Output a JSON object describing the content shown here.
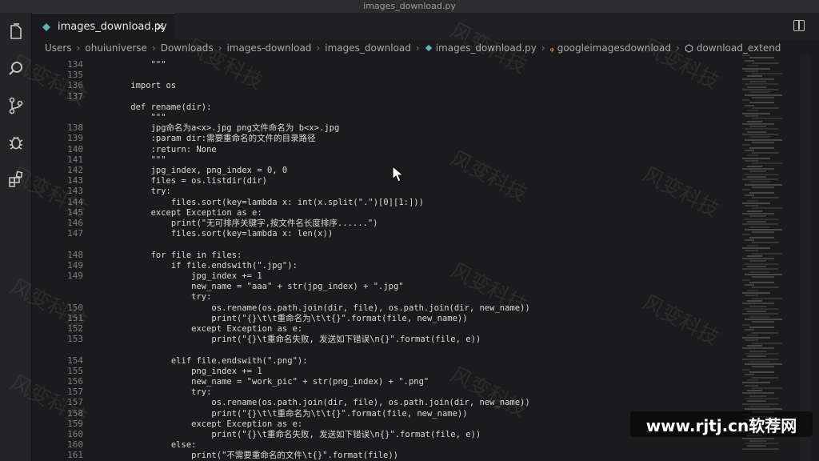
{
  "window": {
    "title": "images_download.py"
  },
  "tab": {
    "label": "images_download.py"
  },
  "breadcrumb": [
    "Users",
    "ohuiuniverse",
    "Downloads",
    "images-download",
    "images_download",
    "images_download.py",
    "googleimagesdownload",
    "download_extended_page"
  ],
  "code_lines": [
    {
      "n": "134",
      "text": "        \"\"\""
    },
    {
      "n": "135",
      "text": ""
    },
    {
      "n": "136",
      "text": "    import os"
    },
    {
      "n": "137",
      "text": ""
    },
    {
      "n": "",
      "text": "    def rename(dir):"
    },
    {
      "n": "",
      "text": "        \"\"\""
    },
    {
      "n": "138",
      "text": "        jpg命名为a<x>.jpg png文件命名为 b<x>.jpg"
    },
    {
      "n": "139",
      "text": "        :param dir:需要重命名的文件的目录路径"
    },
    {
      "n": "140",
      "text": "        :return: None"
    },
    {
      "n": "141",
      "text": "        \"\"\""
    },
    {
      "n": "142",
      "text": "        jpg_index, png_index = 0, 0"
    },
    {
      "n": "143",
      "text": "        files = os.listdir(dir)"
    },
    {
      "n": "143",
      "text": "        try:"
    },
    {
      "n": "144",
      "text": "            files.sort(key=lambda x: int(x.split(\".\")[0][1:]))"
    },
    {
      "n": "145",
      "text": "        except Exception as e:"
    },
    {
      "n": "146",
      "text": "            print(\"无可排序关键字,按文件名长度排序......\")"
    },
    {
      "n": "147",
      "text": "            files.sort(key=lambda x: len(x))"
    },
    {
      "n": "",
      "text": ""
    },
    {
      "n": "148",
      "text": "        for file in files:"
    },
    {
      "n": "149",
      "text": "            if file.endswith(\".jpg\"):"
    },
    {
      "n": "149",
      "text": "                jpg_index += 1"
    },
    {
      "n": "",
      "text": "                new_name = \"aaa\" + str(jpg_index) + \".jpg\""
    },
    {
      "n": "",
      "text": "                try:"
    },
    {
      "n": "150",
      "text": "                    os.rename(os.path.join(dir, file), os.path.join(dir, new_name))"
    },
    {
      "n": "151",
      "text": "                    print(\"{}\\t\\t重命名为\\t\\t{}\".format(file, new_name))"
    },
    {
      "n": "152",
      "text": "                except Exception as e:"
    },
    {
      "n": "153",
      "text": "                    print(\"{}\\t重命名失败, 发送如下错误\\n{}\".format(file, e))"
    },
    {
      "n": "",
      "text": ""
    },
    {
      "n": "154",
      "text": "            elif file.endswith(\".png\"):"
    },
    {
      "n": "155",
      "text": "                png_index += 1"
    },
    {
      "n": "156",
      "text": "                new_name = \"work_pic\" + str(png_index) + \".png\""
    },
    {
      "n": "157",
      "text": "                try:"
    },
    {
      "n": "157",
      "text": "                    os.rename(os.path.join(dir, file), os.path.join(dir, new_name))"
    },
    {
      "n": "158",
      "text": "                    print(\"{}\\t\\t重命名为\\t\\t{}\".format(file, new_name))"
    },
    {
      "n": "159",
      "text": "                except Exception as e:"
    },
    {
      "n": "160",
      "text": "                    print(\"{}\\t重命名失败, 发送如下错误\\n{}\".format(file, e))"
    },
    {
      "n": "160",
      "text": "            else:"
    },
    {
      "n": "161",
      "text": "                print(\"不需要重命名的文件\\t{}\".format(file))"
    }
  ],
  "watermark": {
    "text": "风变科技",
    "site": "www.rjtj.cn软荐网"
  }
}
